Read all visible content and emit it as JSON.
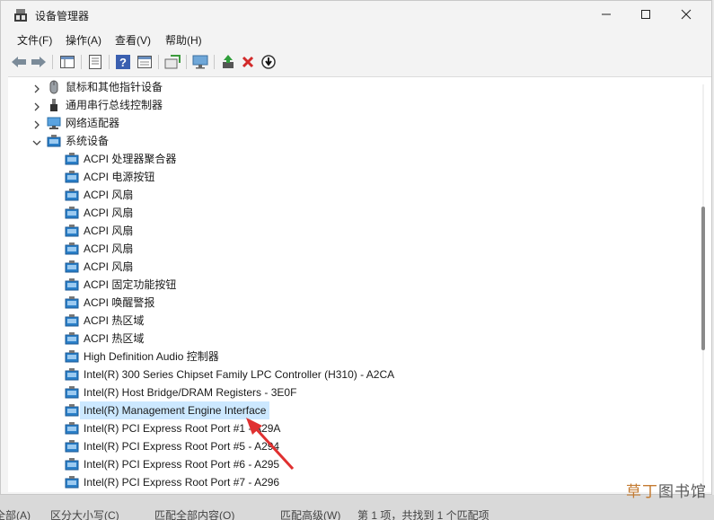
{
  "window": {
    "title": "设备管理器",
    "controls": {
      "minimize": "—",
      "maximize": "☐",
      "close": "✕"
    }
  },
  "menu": [
    "文件(F)",
    "操作(A)",
    "查看(V)",
    "帮助(H)"
  ],
  "toolbar_icons": [
    "back-icon",
    "forward-icon",
    "properties-pane-icon",
    "document-icon",
    "help-icon",
    "view-icon",
    "scan-icon",
    "monitor-icon",
    "update-driver-icon",
    "uninstall-icon",
    "download-icon"
  ],
  "tree": [
    {
      "label": "鼠标和其他指针设备",
      "expander": "collapsed",
      "icon": "mouse-icon",
      "level": 1
    },
    {
      "label": "通用串行总线控制器",
      "expander": "collapsed",
      "icon": "usb-icon",
      "level": 1
    },
    {
      "label": "网络适配器",
      "expander": "collapsed",
      "icon": "network-icon",
      "level": 1
    },
    {
      "label": "系统设备",
      "expander": "expanded",
      "icon": "system-device-icon",
      "level": 1
    },
    {
      "label": "ACPI 处理器聚合器",
      "level": 2
    },
    {
      "label": "ACPI 电源按钮",
      "level": 2
    },
    {
      "label": "ACPI 风扇",
      "level": 2
    },
    {
      "label": "ACPI 风扇",
      "level": 2
    },
    {
      "label": "ACPI 风扇",
      "level": 2
    },
    {
      "label": "ACPI 风扇",
      "level": 2
    },
    {
      "label": "ACPI 风扇",
      "level": 2
    },
    {
      "label": "ACPI 固定功能按钮",
      "level": 2
    },
    {
      "label": "ACPI 唤醒警报",
      "level": 2
    },
    {
      "label": "ACPI 热区域",
      "level": 2
    },
    {
      "label": "ACPI 热区域",
      "level": 2
    },
    {
      "label": "High Definition Audio 控制器",
      "level": 2
    },
    {
      "label": "Intel(R) 300 Series Chipset Family LPC Controller (H310) - A2CA",
      "level": 2
    },
    {
      "label": "Intel(R) Host Bridge/DRAM Registers - 3E0F",
      "level": 2
    },
    {
      "label": "Intel(R) Management Engine Interface",
      "level": 2,
      "selected": true
    },
    {
      "label": "Intel(R) PCI Express Root Port #1 - A29A",
      "level": 2
    },
    {
      "label": "Intel(R) PCI Express Root Port #5 - A294",
      "level": 2
    },
    {
      "label": "Intel(R) PCI Express Root Port #6 - A295",
      "level": 2
    },
    {
      "label": "Intel(R) PCI Express Root Port #7 - A296",
      "level": 2
    }
  ],
  "background_status": [
    "全部(A)",
    "区分大小写(C)",
    "匹配全部内容(O)",
    "匹配高级(W)",
    "第 1 项，共找到 1 个匹配项"
  ],
  "watermark": {
    "accent": "草丁",
    "rest": "图书馆"
  },
  "colors": {
    "selection": "#cce8ff",
    "accent_red": "#e03030",
    "folder_blue": "#2a7fc8"
  }
}
